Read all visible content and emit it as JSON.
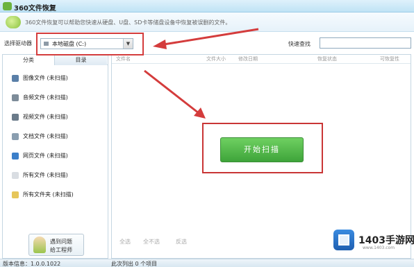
{
  "window": {
    "title": "360文件恢复"
  },
  "header": {
    "tip": "360文件恢复可以帮助您快速从硬盘、U盘、SD卡等储盘设备中恢复被误删的文件。"
  },
  "toolbar": {
    "drive_label": "选择驱动器",
    "drive_value": "本地磁盘 (C:)",
    "search_label": "快速查找",
    "search_value": ""
  },
  "sidebar": {
    "tabs": [
      "分类",
      "目录"
    ],
    "items": [
      {
        "label": "图像文件 (未扫描)",
        "icon": "image-file-icon",
        "color": "#5a7fa8"
      },
      {
        "label": "音频文件 (未扫描)",
        "icon": "audio-file-icon",
        "color": "#7d8c99"
      },
      {
        "label": "视频文件 (未扫描)",
        "icon": "video-file-icon",
        "color": "#6b7b8a"
      },
      {
        "label": "文档文件 (未扫描)",
        "icon": "document-file-icon",
        "color": "#8a9eb0"
      },
      {
        "label": "网页文件 (未扫描)",
        "icon": "webpage-file-icon",
        "color": "#3c7fc9"
      },
      {
        "label": "所有文件 (未扫描)",
        "icon": "all-files-icon",
        "color": "#d9dde2"
      },
      {
        "label": "所有文件夹 (未扫描)",
        "icon": "folder-icon",
        "color": "#e6c65a"
      }
    ],
    "help_button": {
      "line1": "遇到问题",
      "line2": "给工程师"
    }
  },
  "main": {
    "columns": [
      "文件名",
      "文件大小",
      "修改日期",
      "恢复状态",
      "可恢复性"
    ],
    "start_button": "开始扫描",
    "actions": [
      "全选",
      "全不选",
      "反选"
    ]
  },
  "status": {
    "version": "版本信息：1.0.0.1022",
    "count": "此次列出 0 个项目"
  },
  "watermark": {
    "name": "1403手游网",
    "url": "www.1403.com"
  },
  "colors": {
    "accent_red": "#d43c3c",
    "button_green": "#4cb845",
    "header_blue": "#bfe3f5"
  }
}
